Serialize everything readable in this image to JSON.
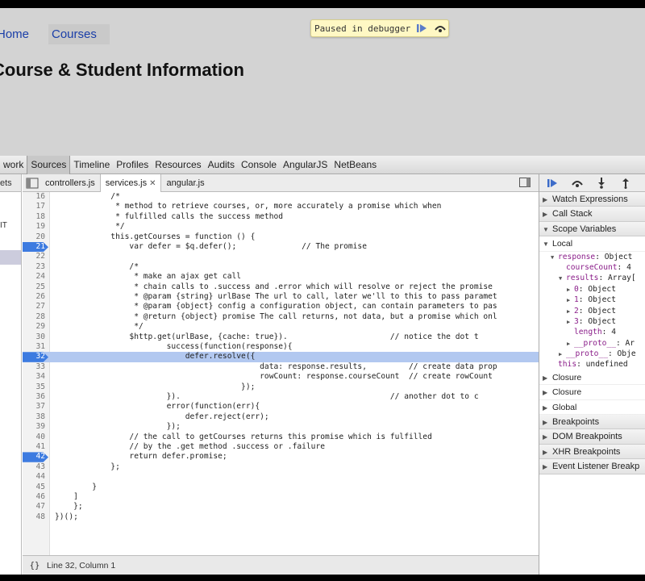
{
  "page": {
    "nav": {
      "home": "Home",
      "courses": "Courses"
    },
    "title": "Course & Student Information",
    "paused_text": "Paused in debugger"
  },
  "devtools": {
    "tabs": [
      "work",
      "Sources",
      "Timeline",
      "Profiles",
      "Resources",
      "Audits",
      "Console",
      "AngularJS",
      "NetBeans"
    ],
    "active_tab": "Sources",
    "left_pane": {
      "header": "ets",
      "rows": [
        "",
        "",
        "IT",
        "",
        "",
        "",
        ""
      ]
    },
    "file_tabs": [
      {
        "label": "controllers.js",
        "closable": false
      },
      {
        "label": "services.js",
        "closable": true
      },
      {
        "label": "angular.js",
        "closable": false
      }
    ],
    "active_file": "services.js",
    "status": "Line 32, Column 1",
    "status_braces": "{}",
    "code": [
      {
        "n": "16",
        "t": "            /*"
      },
      {
        "n": "17",
        "t": "             * method to retrieve courses, or, more accurately a promise which when"
      },
      {
        "n": "18",
        "t": "             * fulfilled calls the success method"
      },
      {
        "n": "19",
        "t": "             */"
      },
      {
        "n": "20",
        "t": "            this.getCourses = function () {"
      },
      {
        "n": "21",
        "t": "                var defer = $q.defer();              // The promise",
        "bp": true
      },
      {
        "n": "22",
        "t": ""
      },
      {
        "n": "23",
        "t": "                /*"
      },
      {
        "n": "24",
        "t": "                 * make an ajax get call"
      },
      {
        "n": "25",
        "t": "                 * chain calls to .success and .error which will resolve or reject the promise"
      },
      {
        "n": "26",
        "t": "                 * @param {string} urlBase The url to call, later we'll to this to pass paramet"
      },
      {
        "n": "27",
        "t": "                 * @param {object} config a configuration object, can contain parameters to pas"
      },
      {
        "n": "28",
        "t": "                 * @return {object} promise The call returns, not data, but a promise which onl"
      },
      {
        "n": "29",
        "t": "                 */"
      },
      {
        "n": "30",
        "t": "                $http.get(urlBase, {cache: true}).                      // notice the dot t"
      },
      {
        "n": "31",
        "t": "                        success(function(response){"
      },
      {
        "n": "32",
        "t": "                            defer.resolve({",
        "bp": true,
        "hl": true
      },
      {
        "n": "33",
        "t": "                                            data: response.results,         // create data prop"
      },
      {
        "n": "34",
        "t": "                                            rowCount: response.courseCount  // create rowCount"
      },
      {
        "n": "35",
        "t": "                                        });"
      },
      {
        "n": "36",
        "t": "                        }).                                             // another dot to c"
      },
      {
        "n": "37",
        "t": "                        error(function(err){"
      },
      {
        "n": "38",
        "t": "                            defer.reject(err);"
      },
      {
        "n": "39",
        "t": "                        });"
      },
      {
        "n": "40",
        "t": "                // the call to getCourses returns this promise which is fulfilled"
      },
      {
        "n": "41",
        "t": "                // by the .get method .success or .failure"
      },
      {
        "n": "42",
        "t": "                return defer.promise;",
        "bp": true
      },
      {
        "n": "43",
        "t": "            };"
      },
      {
        "n": "44",
        "t": ""
      },
      {
        "n": "45",
        "t": "        }"
      },
      {
        "n": "46",
        "t": "    ]"
      },
      {
        "n": "47",
        "t": "    };"
      },
      {
        "n": "48",
        "t": "})();"
      }
    ],
    "sidebar": {
      "watch": "Watch Expressions",
      "call_stack": "Call Stack",
      "scope": "Scope Variables",
      "local": "Local",
      "vars": [
        {
          "depth": 1,
          "tri": "▼",
          "name": "response",
          "value": ": Object"
        },
        {
          "depth": 2,
          "tri": "",
          "name": "courseCount",
          "value": ": 4"
        },
        {
          "depth": 2,
          "tri": "▼",
          "name": "results",
          "value": ": Array["
        },
        {
          "depth": 3,
          "tri": "▶",
          "name": "0",
          "value": ": Object"
        },
        {
          "depth": 3,
          "tri": "▶",
          "name": "1",
          "value": ": Object"
        },
        {
          "depth": 3,
          "tri": "▶",
          "name": "2",
          "value": ": Object"
        },
        {
          "depth": 3,
          "tri": "▶",
          "name": "3",
          "value": ": Object"
        },
        {
          "depth": 3,
          "tri": "",
          "name": "length",
          "value": ": 4"
        },
        {
          "depth": 3,
          "tri": "▶",
          "name": "__proto__",
          "value": ": Ar"
        },
        {
          "depth": 2,
          "tri": "▶",
          "name": "__proto__",
          "value": ": Obje"
        },
        {
          "depth": 1,
          "tri": "",
          "name": "this",
          "value": ": undefined"
        }
      ],
      "closures": [
        "Closure",
        "Closure",
        "Global"
      ],
      "bottom_sections": [
        "Breakpoints",
        "DOM Breakpoints",
        "XHR Breakpoints",
        "Event Listener Breakp"
      ]
    }
  }
}
